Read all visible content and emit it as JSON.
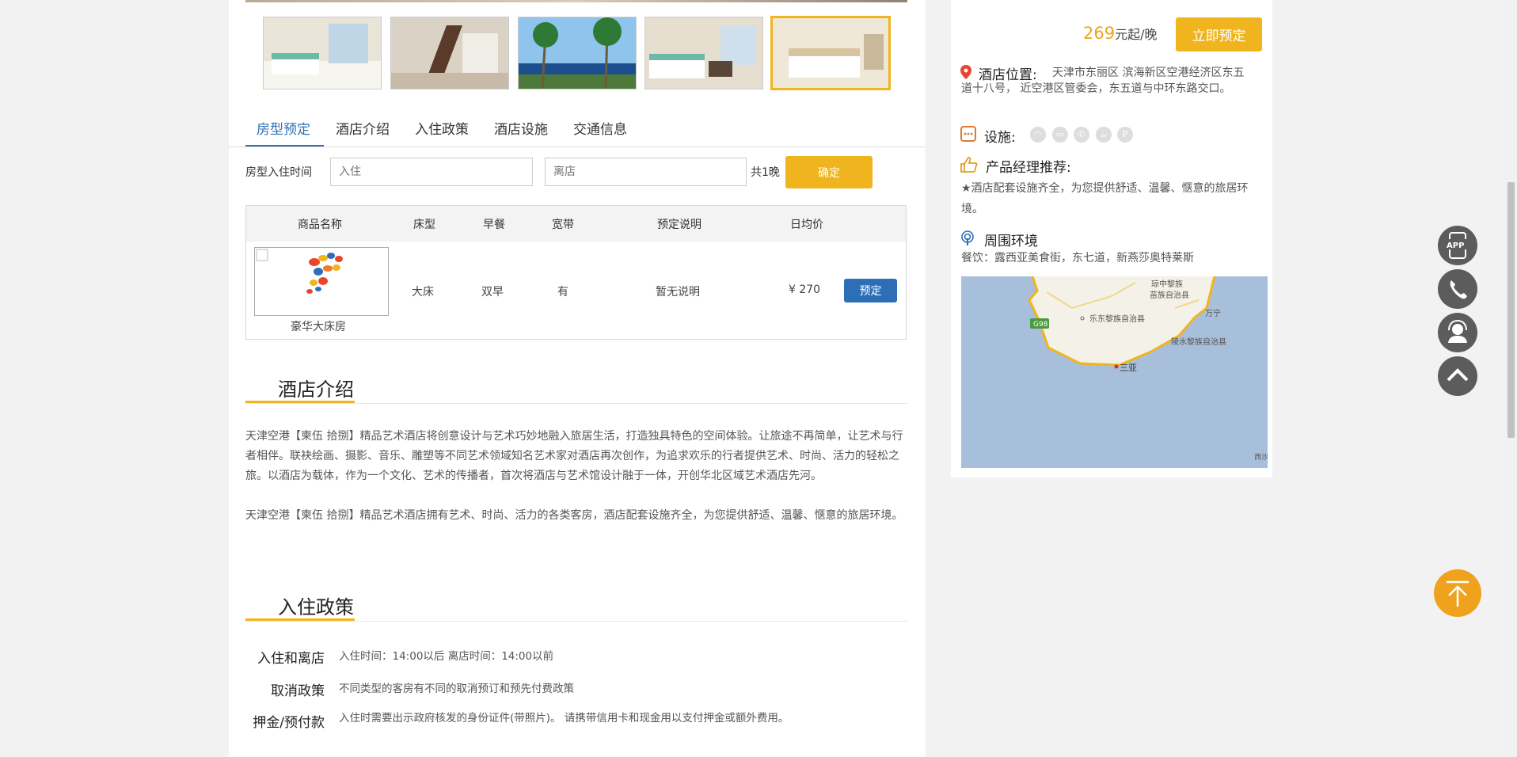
{
  "tabs": [
    {
      "label": "房型预定"
    },
    {
      "label": "酒店介绍"
    },
    {
      "label": "入住政策"
    },
    {
      "label": "酒店设施"
    },
    {
      "label": "交通信息"
    }
  ],
  "booking": {
    "label": "房型入住时间",
    "checkin_placeholder": "入住",
    "checkout_placeholder": "离店",
    "nights": "共1晚",
    "confirm": "确定"
  },
  "room_table": {
    "headers": [
      "商品名称",
      "床型",
      "早餐",
      "宽带",
      "预定说明",
      "日均价"
    ],
    "rows": [
      {
        "name": "豪华大床房",
        "bed": "大床",
        "breakfast": "双早",
        "broadband": "有",
        "note": "暂无说明",
        "price": "¥ 270",
        "action": "预定"
      }
    ]
  },
  "intro": {
    "title": "酒店介绍",
    "p1": "天津空港【柬伍  拾捌】精品艺术酒店将创意设计与艺术巧妙地融入旅居生活，打造独具特色的空间体验。让旅途不再简单，让艺术与行者相伴。联袂绘画、摄影、音乐、雕塑等不同艺术领域知名艺术家对酒店再次创作，为追求欢乐的行者提供艺术、时尚、活力的轻松之旅。以酒店为载体，作为一个文化、艺术的传播者，首次将酒店与艺术馆设计融于一体，开创华北区域艺术酒店先河。",
    "p2": "天津空港【柬伍 拾捌】精品艺术酒店拥有艺术、时尚、活力的各类客房，酒店配套设施齐全，为您提供舒适、温馨、惬意的旅居环境。"
  },
  "policy": {
    "title": "入住政策",
    "items": [
      {
        "label": "入住和离店",
        "text": "入住时间：14:00以后 离店时间：14:00以前"
      },
      {
        "label": "取消政策",
        "text": "不同类型的客房有不同的取消预订和预先付费政策"
      },
      {
        "label": "押金/预付款",
        "text": "入住时需要出示政府核发的身份证件(带照片)。 请携带信用卡和现金用以支付押金或额外费用。"
      }
    ]
  },
  "sidebar": {
    "price": "269",
    "price_unit": "元起/晚",
    "book_now": "立即预定",
    "location_label": "酒店位置:",
    "location_text": "天津市东丽区 滨海新区空港经济区东五道十八号， 近空港区管委会，东五道与中环东路交口。",
    "facilities_label": "设施:",
    "facility_icons": [
      "wifi-icon",
      "tv-icon",
      "phone-icon",
      "cup-icon",
      "parking-icon"
    ],
    "pm_label": "产品经理推荐:",
    "pm_text": "★酒店配套设施齐全，为您提供舒适、温馨、惬意的旅居环境。",
    "env_label": "周围环境",
    "env_text": "餐饮：露西亚美食街，东七道，新燕莎奥特莱斯",
    "map_labels": {
      "a": "琼中黎族",
      "b": "苗族自治县",
      "c": "乐东黎族自治县",
      "d": "万宁",
      "e": "陵水黎族自治县",
      "f": "三亚",
      "g": "G98",
      "h": "西沙"
    }
  },
  "floating": {
    "app": "APP"
  },
  "colors": {
    "accent": "#f0b41e",
    "blue": "#2d6fb7",
    "price": "#f0a21e"
  }
}
